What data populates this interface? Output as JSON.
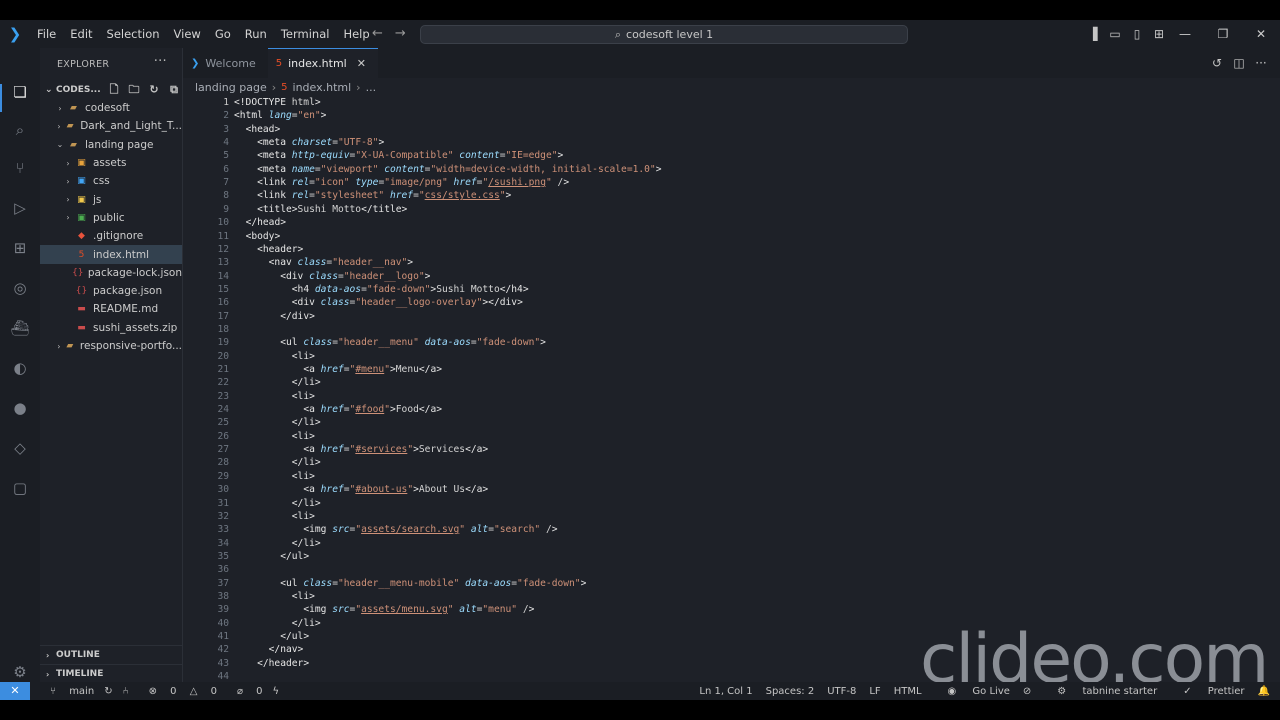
{
  "titlebar": {
    "menus": [
      "File",
      "Edit",
      "Selection",
      "View",
      "Go",
      "Run",
      "Terminal",
      "Help"
    ],
    "command_center": "codesoft level 1"
  },
  "sidebar": {
    "title": "EXPLORER",
    "workspace": "CODES...",
    "tree": [
      {
        "name": "codesoft",
        "type": "folder",
        "depth": 1,
        "expanded": false
      },
      {
        "name": "Dark_and_Light_T...",
        "type": "folder",
        "depth": 1,
        "expanded": false
      },
      {
        "name": "landing page",
        "type": "folder",
        "depth": 1,
        "expanded": true
      },
      {
        "name": "assets",
        "type": "folder",
        "depth": 2,
        "expanded": false
      },
      {
        "name": "css",
        "type": "folder",
        "depth": 2,
        "expanded": false
      },
      {
        "name": "js",
        "type": "folder",
        "depth": 2,
        "expanded": false
      },
      {
        "name": "public",
        "type": "folder",
        "depth": 2,
        "expanded": false
      },
      {
        "name": ".gitignore",
        "type": "file",
        "depth": 2
      },
      {
        "name": "index.html",
        "type": "file",
        "depth": 2,
        "selected": true
      },
      {
        "name": "package-lock.json",
        "type": "file",
        "depth": 2
      },
      {
        "name": "package.json",
        "type": "file",
        "depth": 2
      },
      {
        "name": "README.md",
        "type": "file",
        "depth": 2
      },
      {
        "name": "sushi_assets.zip",
        "type": "file",
        "depth": 2
      },
      {
        "name": "responsive-portfo...",
        "type": "folder",
        "depth": 1,
        "expanded": false
      }
    ],
    "outline": "OUTLINE",
    "timeline": "TIMELINE"
  },
  "tabs": [
    {
      "label": "Welcome",
      "active": false
    },
    {
      "label": "index.html",
      "active": true
    }
  ],
  "breadcrumb": {
    "folder": "landing page",
    "file": "index.html",
    "more": "..."
  },
  "code_lines": [
    "<!DOCTYPE html>",
    "<html lang=\"en\">",
    "  <head>",
    "    <meta charset=\"UTF-8\">",
    "    <meta http-equiv=\"X-UA-Compatible\" content=\"IE=edge\">",
    "    <meta name=\"viewport\" content=\"width=device-width, initial-scale=1.0\">",
    "    <link rel=\"icon\" type=\"image/png\" href=\"/sushi.png\" />",
    "    <link rel=\"stylesheet\" href=\"css/style.css\">",
    "    <title>Sushi Motto</title>",
    "  </head>",
    "  <body>",
    "    <header>",
    "      <nav class=\"header__nav\">",
    "        <div class=\"header__logo\">",
    "          <h4 data-aos=\"fade-down\">Sushi Motto</h4>",
    "          <div class=\"header__logo-overlay\"></div>",
    "        </div>",
    "",
    "        <ul class=\"header__menu\" data-aos=\"fade-down\">",
    "          <li>",
    "            <a href=\"#menu\">Menu</a>",
    "          </li>",
    "          <li>",
    "            <a href=\"#food\">Food</a>",
    "          </li>",
    "          <li>",
    "            <a href=\"#services\">Services</a>",
    "          </li>",
    "          <li>",
    "            <a href=\"#about-us\">About Us</a>",
    "          </li>",
    "          <li>",
    "            <img src=\"assets/search.svg\" alt=\"search\" />",
    "          </li>",
    "        </ul>",
    "",
    "        <ul class=\"header__menu-mobile\" data-aos=\"fade-down\">",
    "          <li>",
    "            <img src=\"assets/menu.svg\" alt=\"menu\" />",
    "          </li>",
    "        </ul>",
    "      </nav>",
    "    </header>",
    ""
  ],
  "statusbar": {
    "branch": "main",
    "errors": "0",
    "warnings": "0",
    "ports": "0",
    "position": "Ln 1, Col 1",
    "spaces": "Spaces: 2",
    "encoding": "UTF-8",
    "eol": "LF",
    "language": "HTML",
    "golive": "Go Live",
    "tabnine": "tabnine starter",
    "prettier": "Prettier"
  },
  "watermark": "clideo.com",
  "colors": {
    "accent": "#3c8de0",
    "background": "#1e2128",
    "string": "#ce9178",
    "attribute": "#9cdcfe"
  }
}
